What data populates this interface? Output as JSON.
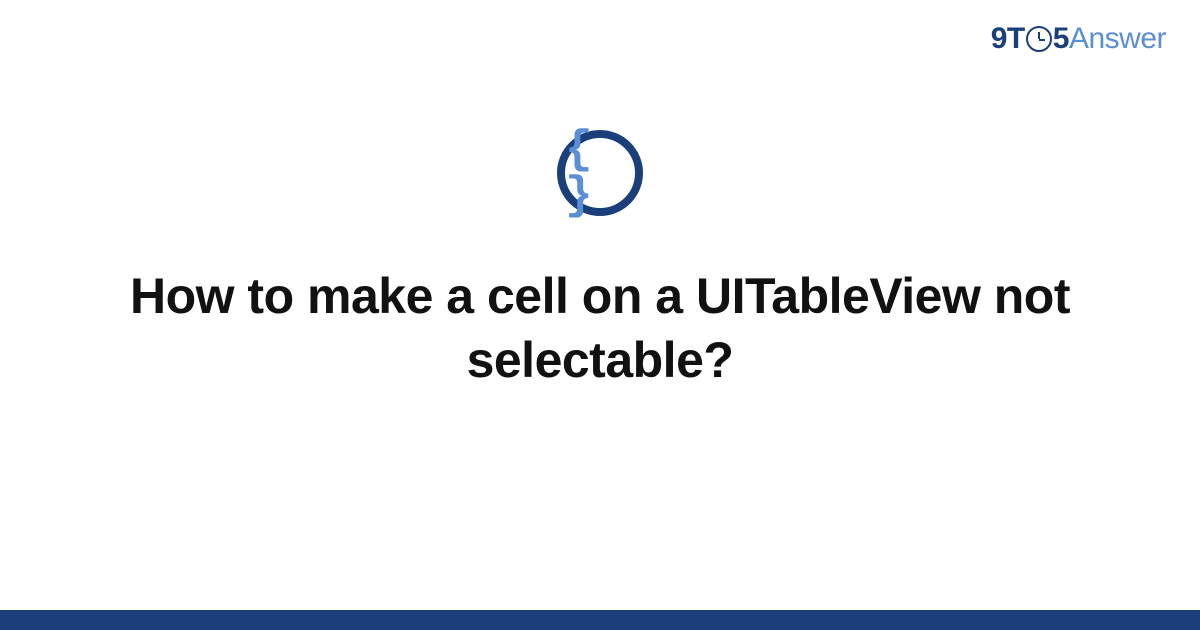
{
  "logo": {
    "part1": "9T",
    "part2": "5",
    "part3": "Answer"
  },
  "icon": {
    "braces": "{ }"
  },
  "title": "How to make a cell on a UITableView not selectable?",
  "colors": {
    "primary": "#1a3f7a",
    "accent": "#5a8fd6"
  }
}
